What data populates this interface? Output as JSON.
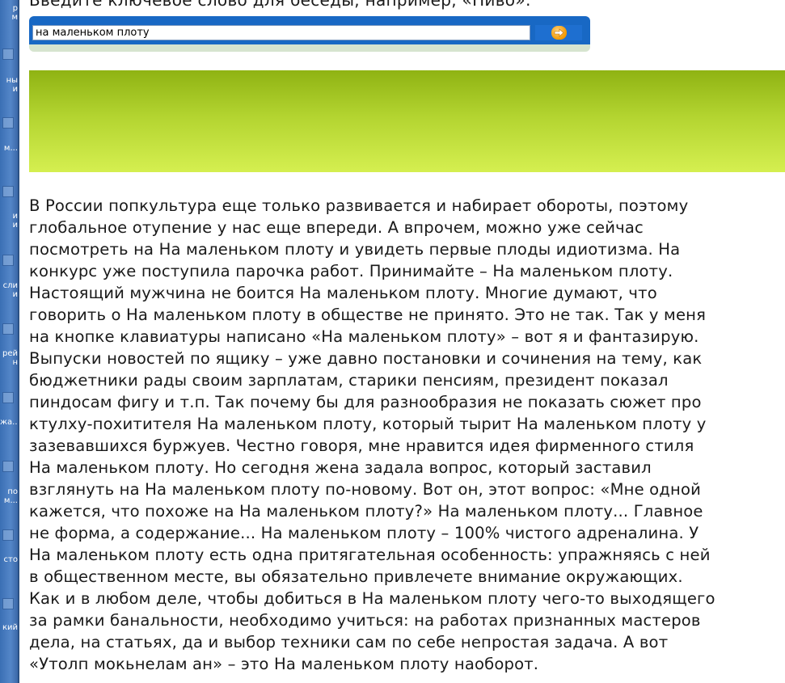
{
  "desktop": {
    "labels": [
      "р\nм",
      "ны\nи",
      "м...",
      "и\nи",
      "сли\nи",
      "рей\nн",
      "жа...",
      "по\nм...",
      "сто",
      "кий"
    ]
  },
  "header": {
    "prompt": "Введите ключевое слово для беседы, например, «Пиво»:"
  },
  "search": {
    "value": "на маленьком плоту",
    "go_icon": "arrow-right-icon",
    "go_color": "#f39800"
  },
  "banner": {
    "color_top": "#8fb313",
    "color_bottom": "#d5ef50"
  },
  "article": {
    "lines": [
      "В России попкультура еще только развивается и набирает обороты, поэтому",
      "глобальное отупение у нас еще впереди. А впрочем, можно уже сейчас",
      "посмотреть на На маленьком плоту и увидеть первые плоды идиотизма. На",
      "конкурс уже поступила парочка работ. Принимайте – На маленьком плоту.",
      "Настоящий мужчина не боится На маленьком плоту. Многие думают, что",
      "говорить о На маленьком плоту в обществе не принято. Это не так. Так у меня",
      "на кнопке клавиатуры написано «На маленьком плоту» – вот я и фантазирую.",
      "Выпуски новостей по ящику – уже давно постановки и сочинения на тему, как",
      "бюджетники рады своим зарплатам, старики пенсиям, президент показал",
      "пиндосам фигу и т.п. Так почему бы для разнообразия не показать сюжет про",
      "ктулху-похитителя На маленьком плоту, который тырит На маленьком плоту у",
      "зазевавшихся буржуев. Честно говоря, мне нравится идея фирменного стиля",
      "На маленьком плоту. Но сегодня жена задала вопрос, который заставил",
      "взглянуть на На маленьком плоту по-новому. Вот он, этот вопрос: «Мне одной",
      "кажется, что похоже на На маленьком плоту?» На маленьком плоту... Главное",
      "не форма, а содержание... На маленьком плоту – 100% чистого адреналина. У",
      "На маленьком плоту есть одна притягательная особенность: упражняясь с ней",
      "в общественном месте, вы обязательно привлечете внимание окружающих.",
      "Как и в любом деле, чтобы добиться в На маленьком плоту чего-то выходящего",
      "за рамки банальности, необходимо учиться: на работах признанных мастеров",
      "дела, на статьях, да и выбор техники сам по себе непростая задача. А вот",
      "«Утолп мокьнелам ан» – это На маленьком плоту наоборот."
    ]
  }
}
